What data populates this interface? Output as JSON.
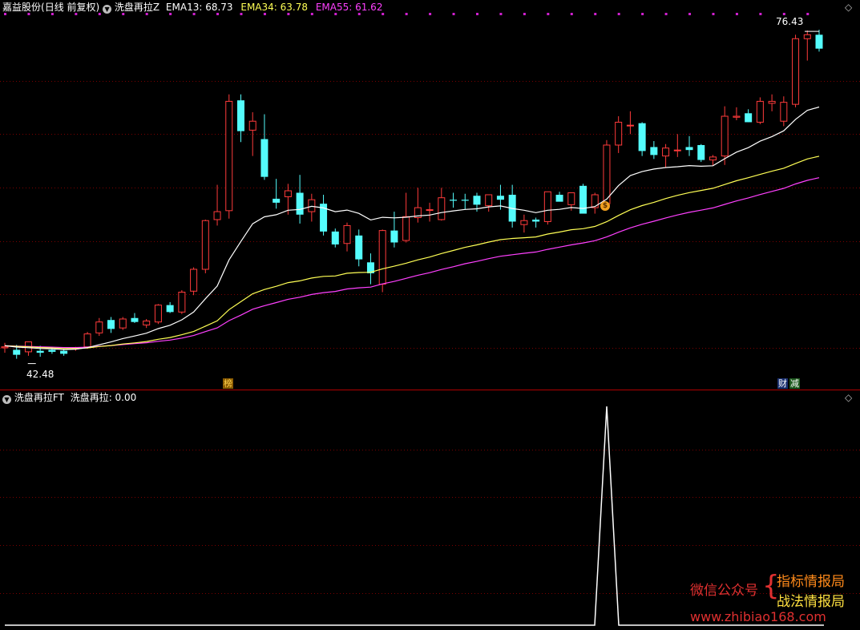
{
  "header": {
    "stock_name": "嘉益股份",
    "period_label": "(日线 前复权)",
    "indicator_name": "洗盘再拉Z",
    "ema13_label": "EMA13: 68.73",
    "ema34_label": "EMA34: 63.78",
    "ema55_label": "EMA55: 61.62"
  },
  "lower_header": {
    "indicator_name": "洗盘再拉FT",
    "value_label": "洗盘再拉: 0.00"
  },
  "markers": {
    "high_price": "76.43",
    "low_price": "42.48",
    "badge_bang": "榜",
    "badge_cai": "财",
    "badge_jian": "减",
    "coin": "$"
  },
  "watermark": {
    "left": "微信公众号",
    "line1": "指标情报局",
    "line2": "战法情报局",
    "url": "www.zhibiao168.com"
  },
  "colors": {
    "up": "#ff3b3b",
    "down": "#54fcfc",
    "ema13": "#ffffff",
    "ema34": "#ffff55",
    "ema55": "#ff40ff",
    "grid": "#7a0000",
    "divider": "#b00000"
  },
  "chart_data": [
    {
      "type": "candlestick",
      "y_range": [
        42.48,
        76.43
      ],
      "series_candles": [
        [
          44.5,
          45.0,
          44.0,
          44.6
        ],
        [
          44.3,
          44.8,
          43.4,
          43.8
        ],
        [
          44.1,
          44.9,
          43.7,
          45.1
        ],
        [
          44.2,
          44.7,
          43.6,
          44.0
        ],
        [
          44.3,
          44.5,
          43.9,
          44.1
        ],
        [
          44.2,
          44.4,
          43.7,
          43.9
        ],
        [
          44.4,
          44.6,
          44.2,
          44.5
        ],
        [
          44.6,
          46.1,
          44.4,
          45.9
        ],
        [
          46.0,
          47.5,
          45.7,
          47.1
        ],
        [
          47.3,
          47.6,
          46.0,
          46.4
        ],
        [
          46.5,
          47.6,
          46.3,
          47.4
        ],
        [
          47.5,
          48.0,
          47.0,
          47.1
        ],
        [
          46.8,
          47.4,
          46.5,
          47.2
        ],
        [
          47.1,
          48.9,
          46.9,
          48.8
        ],
        [
          48.8,
          49.1,
          48.0,
          48.1
        ],
        [
          48.1,
          50.3,
          47.9,
          50.1
        ],
        [
          50.2,
          52.6,
          49.8,
          52.4
        ],
        [
          52.4,
          57.4,
          52.0,
          57.3
        ],
        [
          57.4,
          60.9,
          56.8,
          58.2
        ],
        [
          58.3,
          70.0,
          57.5,
          69.3
        ],
        [
          69.4,
          70.0,
          65.2,
          66.3
        ],
        [
          66.4,
          68.2,
          63.8,
          67.3
        ],
        [
          65.5,
          68.0,
          61.4,
          61.7
        ],
        [
          59.5,
          61.5,
          58.5,
          59.1
        ],
        [
          59.7,
          61.0,
          57.9,
          60.3
        ],
        [
          60.1,
          61.9,
          57.0,
          57.9
        ],
        [
          58.2,
          60.0,
          57.2,
          59.4
        ],
        [
          59.0,
          59.9,
          55.8,
          56.2
        ],
        [
          56.2,
          56.5,
          54.6,
          54.9
        ],
        [
          55.0,
          57.1,
          54.2,
          56.8
        ],
        [
          55.8,
          56.4,
          52.7,
          53.4
        ],
        [
          53.1,
          54.0,
          50.9,
          52.0
        ],
        [
          50.9,
          56.4,
          50.1,
          56.3
        ],
        [
          56.3,
          58.2,
          54.6,
          55.1
        ],
        [
          55.3,
          60.1,
          55.1,
          57.7
        ],
        [
          57.6,
          60.6,
          57.1,
          58.6
        ],
        [
          58.4,
          59.1,
          57.2,
          58.4
        ],
        [
          57.4,
          60.6,
          57.3,
          59.6
        ],
        [
          59.4,
          60.1,
          58.6,
          59.3
        ],
        [
          59.4,
          60.0,
          58.4,
          59.3
        ],
        [
          59.8,
          60.1,
          58.2,
          58.9
        ],
        [
          58.8,
          59.8,
          58.2,
          59.9
        ],
        [
          59.8,
          60.9,
          58.4,
          59.4
        ],
        [
          59.9,
          60.9,
          56.6,
          57.2
        ],
        [
          56.9,
          57.9,
          56.1,
          57.3
        ],
        [
          57.4,
          57.6,
          56.6,
          57.2
        ],
        [
          57.2,
          60.2,
          56.9,
          60.2
        ],
        [
          59.9,
          60.2,
          59.3,
          59.2
        ],
        [
          58.9,
          60.1,
          58.3,
          60.1
        ],
        [
          60.8,
          61.0,
          58.1,
          58.0
        ],
        [
          58.6,
          60.1,
          58.0,
          59.9
        ],
        [
          59.0,
          65.4,
          58.4,
          64.9
        ],
        [
          64.9,
          67.8,
          64.1,
          67.2
        ],
        [
          66.9,
          68.3,
          66.0,
          66.9
        ],
        [
          67.1,
          67.2,
          63.8,
          64.3
        ],
        [
          64.7,
          65.3,
          63.5,
          63.9
        ],
        [
          63.8,
          65.0,
          62.6,
          64.6
        ],
        [
          64.4,
          66.0,
          63.7,
          64.4
        ],
        [
          64.7,
          65.8,
          63.8,
          64.4
        ],
        [
          64.9,
          65.0,
          63.2,
          63.4
        ],
        [
          63.4,
          63.9,
          62.8,
          63.7
        ],
        [
          63.8,
          68.8,
          62.9,
          67.8
        ],
        [
          67.7,
          68.7,
          67.4,
          67.8
        ],
        [
          68.1,
          68.5,
          67.2,
          67.2
        ],
        [
          67.2,
          69.7,
          67.0,
          69.3
        ],
        [
          69.1,
          70.0,
          68.3,
          69.3
        ],
        [
          67.3,
          69.8,
          66.8,
          69.2
        ],
        [
          69.0,
          76.0,
          68.7,
          75.6
        ],
        [
          75.6,
          76.43,
          73.4,
          76.0
        ],
        [
          76.0,
          76.5,
          74.3,
          74.6
        ]
      ],
      "series": [
        {
          "name": "EMA13",
          "values": [
            44.71,
            44.58,
            44.51,
            44.43,
            44.4,
            44.32,
            44.36,
            44.52,
            44.81,
            45.09,
            45.43,
            45.69,
            45.97,
            46.43,
            46.77,
            47.32,
            48.1,
            49.44,
            50.71,
            53.35,
            55.2,
            56.98,
            57.68,
            57.89,
            58.34,
            58.42,
            58.74,
            58.58,
            58.2,
            58.36,
            58.03,
            57.37,
            57.63,
            57.58,
            57.64,
            57.77,
            57.86,
            58.11,
            58.28,
            58.42,
            58.49,
            58.68,
            58.78,
            58.52,
            58.34,
            58.1,
            58.34,
            58.43,
            58.62,
            58.52,
            58.71,
            59.46,
            60.82,
            61.83,
            62.23,
            62.49,
            62.64,
            62.72,
            62.83,
            62.77,
            62.82,
            63.53,
            64.19,
            64.64,
            65.29,
            65.75,
            66.33,
            67.49,
            68.39,
            68.73
          ]
        },
        {
          "name": "EMA34",
          "values": [
            44.71,
            44.65,
            44.6,
            44.53,
            44.49,
            44.43,
            44.42,
            44.48,
            44.63,
            44.73,
            44.88,
            45.0,
            45.13,
            45.36,
            45.54,
            45.82,
            46.14,
            46.68,
            47.21,
            48.34,
            49.14,
            49.94,
            50.37,
            50.69,
            51.06,
            51.24,
            51.52,
            51.69,
            51.73,
            52.0,
            52.08,
            52.1,
            52.45,
            52.71,
            53.01,
            53.35,
            53.63,
            53.99,
            54.29,
            54.61,
            54.86,
            55.14,
            55.38,
            55.5,
            55.58,
            55.66,
            55.95,
            56.15,
            56.38,
            56.49,
            56.71,
            57.19,
            57.82,
            58.39,
            58.81,
            59.14,
            59.52,
            59.84,
            60.12,
            60.33,
            60.55,
            60.93,
            61.31,
            61.62,
            61.95,
            62.27,
            62.57,
            63.05,
            63.5,
            63.78
          ]
        },
        {
          "name": "EMA55",
          "values": [
            44.71,
            44.67,
            44.64,
            44.6,
            44.57,
            44.53,
            44.53,
            44.57,
            44.66,
            44.73,
            44.83,
            44.92,
            45.01,
            45.16,
            45.28,
            45.48,
            45.74,
            46.13,
            46.5,
            47.24,
            47.79,
            48.38,
            48.74,
            49.05,
            49.38,
            49.59,
            49.87,
            50.05,
            50.17,
            50.42,
            50.54,
            50.61,
            50.93,
            51.18,
            51.49,
            51.8,
            52.06,
            52.38,
            52.66,
            52.96,
            53.2,
            53.47,
            53.71,
            53.87,
            54.01,
            54.14,
            54.41,
            54.63,
            54.86,
            55.05,
            55.28,
            55.66,
            56.13,
            56.57,
            56.93,
            57.24,
            57.57,
            57.87,
            58.13,
            58.35,
            58.58,
            58.93,
            59.28,
            59.58,
            59.92,
            60.24,
            60.54,
            60.99,
            61.35,
            61.62
          ]
        }
      ]
    },
    {
      "type": "line",
      "ylabel": "洗盘再拉",
      "x": [
        0,
        1,
        2,
        3,
        4,
        5,
        6,
        7,
        8,
        9,
        10,
        11,
        12,
        13,
        14,
        15,
        16,
        17,
        18,
        19,
        20,
        21,
        22,
        23,
        24,
        25,
        26,
        27,
        28,
        29,
        30,
        31,
        32,
        33,
        34,
        35,
        36,
        37,
        38,
        39,
        40,
        41,
        42,
        43,
        44,
        45,
        46,
        47,
        48,
        49,
        50,
        51,
        52,
        53,
        54,
        55,
        56,
        57,
        58,
        59,
        60,
        61,
        62,
        63,
        64,
        65,
        66,
        67,
        68,
        69
      ],
      "values": [
        0,
        0,
        0,
        0,
        0,
        0,
        0,
        0,
        0,
        0,
        0,
        0,
        0,
        0,
        0,
        0,
        0,
        0,
        0,
        0,
        0,
        0,
        0,
        0,
        0,
        0,
        0,
        0,
        0,
        0,
        0,
        0,
        0,
        0,
        0,
        0,
        0,
        0,
        0,
        0,
        0,
        0,
        0,
        0,
        0,
        0,
        0,
        0,
        0,
        0,
        0,
        1,
        0,
        0,
        0,
        0,
        0,
        0,
        0,
        0,
        0,
        0,
        0,
        0,
        0,
        0,
        0,
        0,
        0,
        0
      ],
      "y_range": [
        0,
        1
      ]
    }
  ]
}
